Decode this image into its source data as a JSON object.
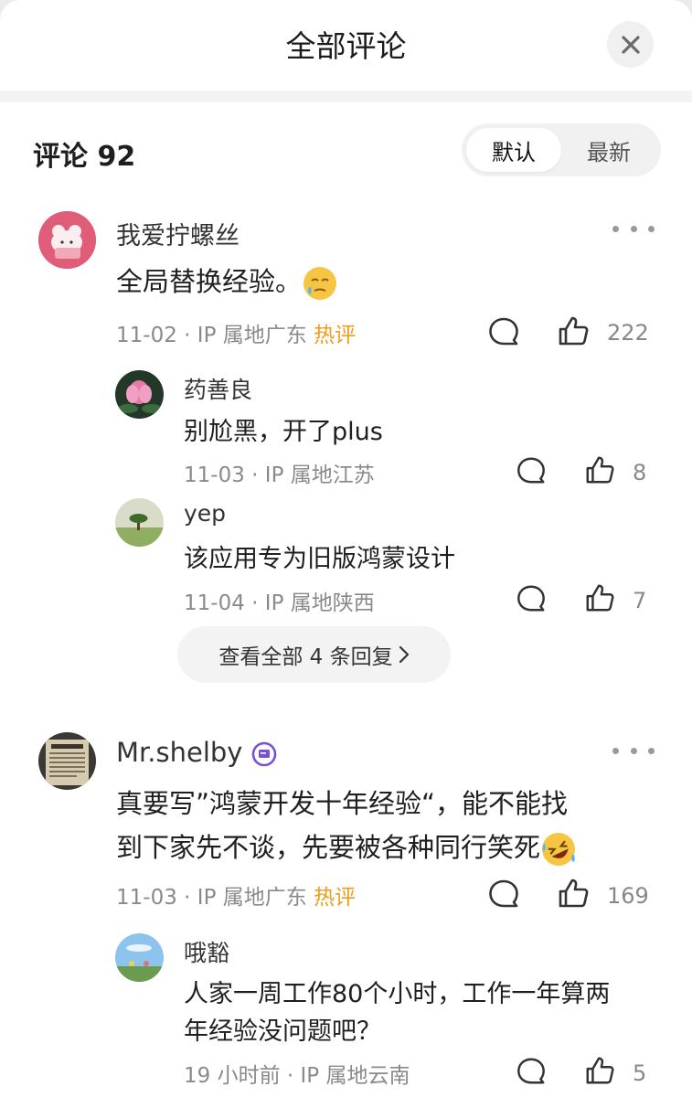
{
  "header": {
    "title": "全部评论"
  },
  "comments_section": {
    "count_label": "评论 92",
    "sort_options": [
      "默认",
      "最新"
    ]
  },
  "comments": [
    {
      "user": "我爱拧螺丝",
      "text": "全局替换经验。",
      "emoji": "sweat-cry-emoji",
      "date": "11-02",
      "location": "IP 属地广东",
      "hot_tag": "热评",
      "likes": "222",
      "replies": [
        {
          "user": "药善良",
          "text": "别尬黑，开了plus",
          "date": "11-03",
          "location": "IP 属地江苏",
          "likes": "8"
        },
        {
          "user": "yep",
          "text": "该应用专为旧版鸿蒙设计",
          "date": "11-04",
          "location": "IP 属地陕西",
          "likes": "7"
        }
      ],
      "view_all_label": "查看全部 4 条回复"
    },
    {
      "user": "Mr.shelby",
      "text_line1": "真要写”鸿蒙开发十年经验“，能不能找",
      "text_line2": "到下家先不谈，先要被各种同行笑死",
      "emoji": "rolling-laugh-emoji",
      "date": "11-03",
      "location": "IP 属地广东",
      "hot_tag": "热评",
      "likes": "169",
      "replies": [
        {
          "user": "哦豁",
          "text_line1": "人家一周工作80个小时，工作一年算两",
          "text_line2": "年经验没问题吧？",
          "date": "19 小时前",
          "location": "IP 属地云南",
          "likes": "5"
        }
      ]
    }
  ],
  "colors": {
    "hot_tag": "#ef9c1a",
    "meta_text": "#8a8a8a",
    "badge": "#7a4fd8"
  },
  "icons": [
    "close-icon",
    "more-icon",
    "comment-icon",
    "like-icon",
    "chevron-right-icon",
    "verified-badge-icon"
  ]
}
